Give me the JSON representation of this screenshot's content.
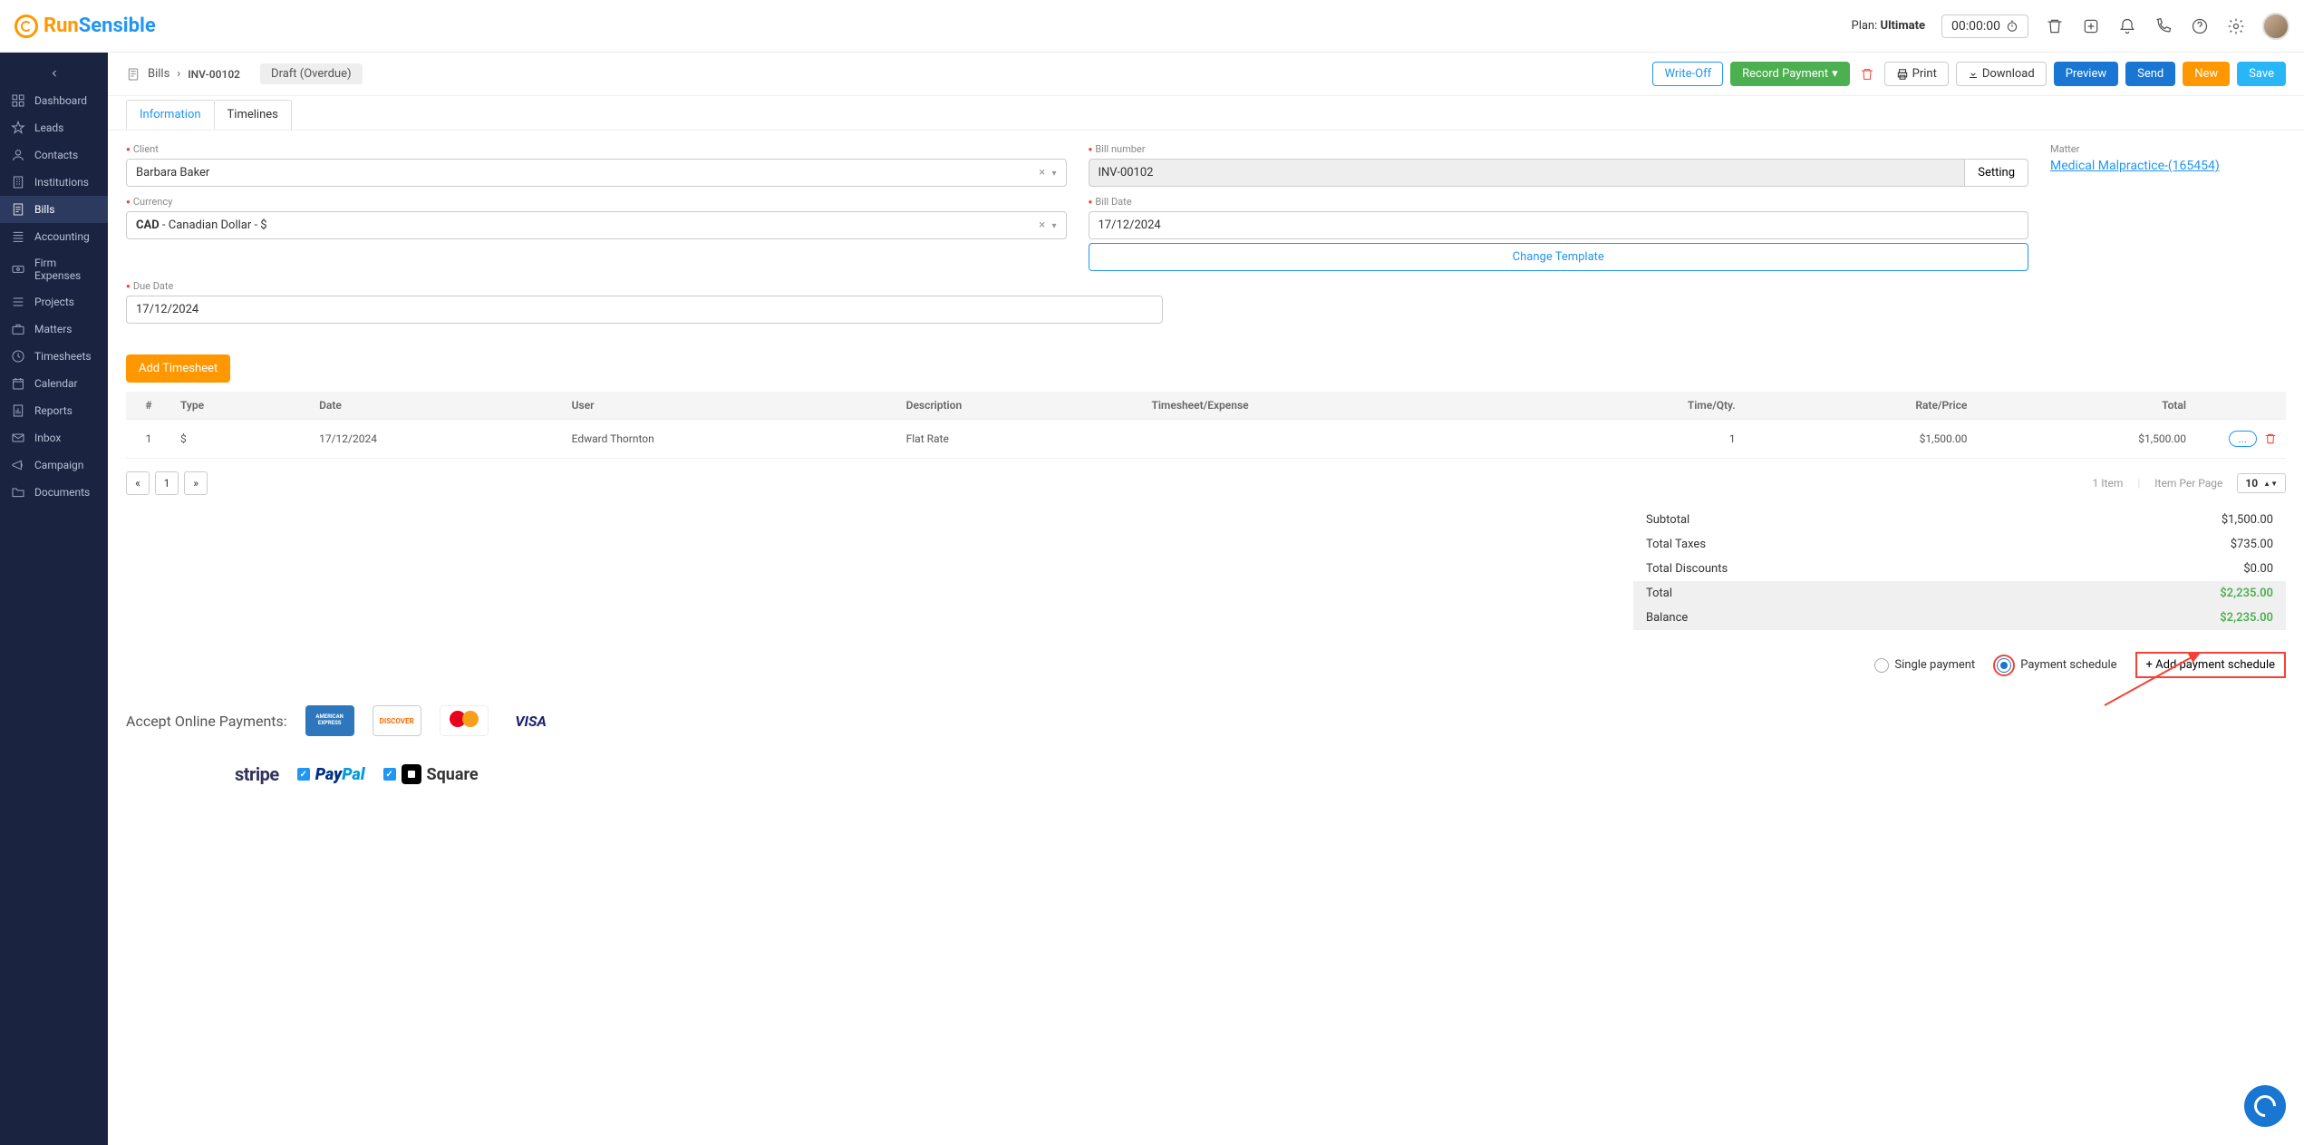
{
  "brand": {
    "part1": "Run",
    "part2": "Sensible"
  },
  "topbar": {
    "plan_label": "Plan: ",
    "plan_name": "Ultimate",
    "timer": "00:00:00"
  },
  "sidebar": {
    "items": [
      {
        "label": "Dashboard",
        "icon": "dashboard"
      },
      {
        "label": "Leads",
        "icon": "star"
      },
      {
        "label": "Contacts",
        "icon": "user"
      },
      {
        "label": "Institutions",
        "icon": "building"
      },
      {
        "label": "Bills",
        "icon": "invoice",
        "active": true
      },
      {
        "label": "Accounting",
        "icon": "ledger"
      },
      {
        "label": "Firm Expenses",
        "icon": "money"
      },
      {
        "label": "Projects",
        "icon": "list"
      },
      {
        "label": "Matters",
        "icon": "briefcase"
      },
      {
        "label": "Timesheets",
        "icon": "clock"
      },
      {
        "label": "Calendar",
        "icon": "calendar"
      },
      {
        "label": "Reports",
        "icon": "report"
      },
      {
        "label": "Inbox",
        "icon": "mail"
      },
      {
        "label": "Campaign",
        "icon": "megaphone"
      },
      {
        "label": "Documents",
        "icon": "folder"
      }
    ]
  },
  "breadcrumb": {
    "parent": "Bills",
    "current": "INV-00102"
  },
  "status": "Draft (Overdue)",
  "actions": {
    "write_off": "Write-Off",
    "record_payment": "Record Payment",
    "print": "Print",
    "download": "Download",
    "preview": "Preview",
    "send": "Send",
    "new": "New",
    "save": "Save"
  },
  "tabs": {
    "information": "Information",
    "timelines": "Timelines"
  },
  "form": {
    "client_label": "Client",
    "client_value": "Barbara Baker",
    "currency_label": "Currency",
    "currency_value": "CAD - Canadian Dollar - $",
    "currency_code": "CAD",
    "currency_rest": " - Canadian Dollar - $",
    "due_date_label": "Due Date",
    "due_date_value": "17/12/2024",
    "bill_number_label": "Bill number",
    "bill_number_value": "INV-00102",
    "setting_button": "Setting",
    "bill_date_label": "Bill Date",
    "bill_date_value": "17/12/2024",
    "change_template": "Change Template",
    "matter_label": "Matter",
    "matter_link": "Medical Malpractice-(165454)"
  },
  "add_timesheet": "Add Timesheet",
  "table": {
    "headers": {
      "num": "#",
      "type": "Type",
      "date": "Date",
      "user": "User",
      "description": "Description",
      "timesheet": "Timesheet/Expense",
      "timeqty": "Time/Qty.",
      "rate": "Rate/Price",
      "total": "Total"
    },
    "rows": [
      {
        "num": "1",
        "type": "$",
        "date": "17/12/2024",
        "user": "Edward Thornton",
        "description": "Flat Rate",
        "timesheet": "",
        "timeqty": "1",
        "rate": "$1,500.00",
        "total": "$1,500.00"
      }
    ]
  },
  "pagination": {
    "prev": "«",
    "page": "1",
    "next": "»",
    "items": "1 Item",
    "per_page_label": "Item Per Page",
    "per_page": "10"
  },
  "totals": {
    "subtotal_label": "Subtotal",
    "subtotal": "$1,500.00",
    "taxes_label": "Total Taxes",
    "taxes": "$735.00",
    "discounts_label": "Total Discounts",
    "discounts": "$0.00",
    "total_label": "Total",
    "total": "$2,235.00",
    "balance_label": "Balance",
    "balance": "$2,235.00"
  },
  "payment": {
    "single": "Single payment",
    "schedule": "Payment schedule",
    "add_schedule": "+ Add payment schedule"
  },
  "payments_section": {
    "title": "Accept Online Payments:",
    "amex": "AMERICAN EXPRESS",
    "discover": "DISCOVER",
    "visa": "VISA",
    "stripe": "stripe",
    "paypal_pay": "Pay",
    "paypal_pal": "Pal",
    "square": "Square"
  }
}
